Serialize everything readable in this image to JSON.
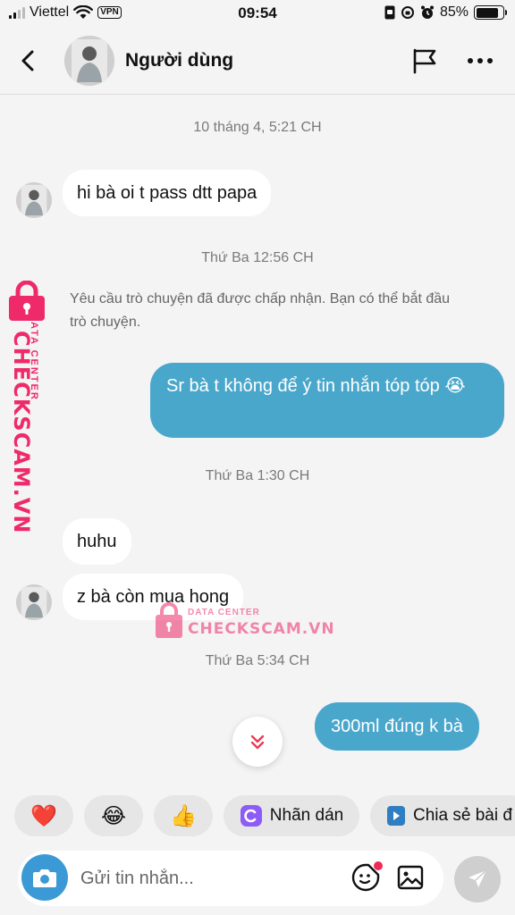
{
  "status_bar": {
    "carrier": "Viettel",
    "vpn": "VPN",
    "time": "09:54",
    "battery": "85%",
    "battery_level": 0.85
  },
  "header": {
    "name": "Người dùng",
    "back_icon": "chevron-left-icon",
    "flag_icon": "flag-icon",
    "more_icon": "more-horizontal-icon"
  },
  "messages": [
    {
      "type": "timestamp",
      "text": "10 tháng 4, 5:21 CH"
    },
    {
      "type": "incoming",
      "text": "hi bà oi t pass dtt papa"
    },
    {
      "type": "timestamp",
      "text": "Thứ Ba 12:56 CH"
    },
    {
      "type": "system",
      "text": "Yêu cầu trò chuyện đã được chấp nhận. Bạn có thể bắt đầu trò chuyện."
    },
    {
      "type": "outgoing",
      "text": "Sr bà t không để ý tin nhắn tóp tóp 😭"
    },
    {
      "type": "timestamp",
      "text": "Thứ Ba 1:30 CH"
    },
    {
      "type": "incoming",
      "text": "huhu"
    },
    {
      "type": "incoming",
      "text": "z bà còn mua hong"
    },
    {
      "type": "timestamp",
      "text": "Thứ Ba 5:34 CH"
    },
    {
      "type": "outgoing",
      "text": "300ml đúng k bà"
    }
  ],
  "watermark": {
    "line1": "DATA CENTER",
    "line2": "CHECKSCAM.VN",
    "color": "#ee2a6a"
  },
  "quick_replies": [
    {
      "emoji": "❤️",
      "label": ""
    },
    {
      "emoji": "😂",
      "label": ""
    },
    {
      "emoji": "👍",
      "label": ""
    },
    {
      "emoji": "sticker-icon",
      "label": "Nhãn dán"
    },
    {
      "emoji": "play-icon",
      "label": "Chia sẻ bài đ"
    }
  ],
  "composer": {
    "placeholder": "Gửi tin nhắn...",
    "camera_color": "#3b9ad6"
  },
  "colors": {
    "outgoing_bubble": "#4aa7cc",
    "incoming_bubble": "#ffffff",
    "background": "#f4f4f4"
  }
}
